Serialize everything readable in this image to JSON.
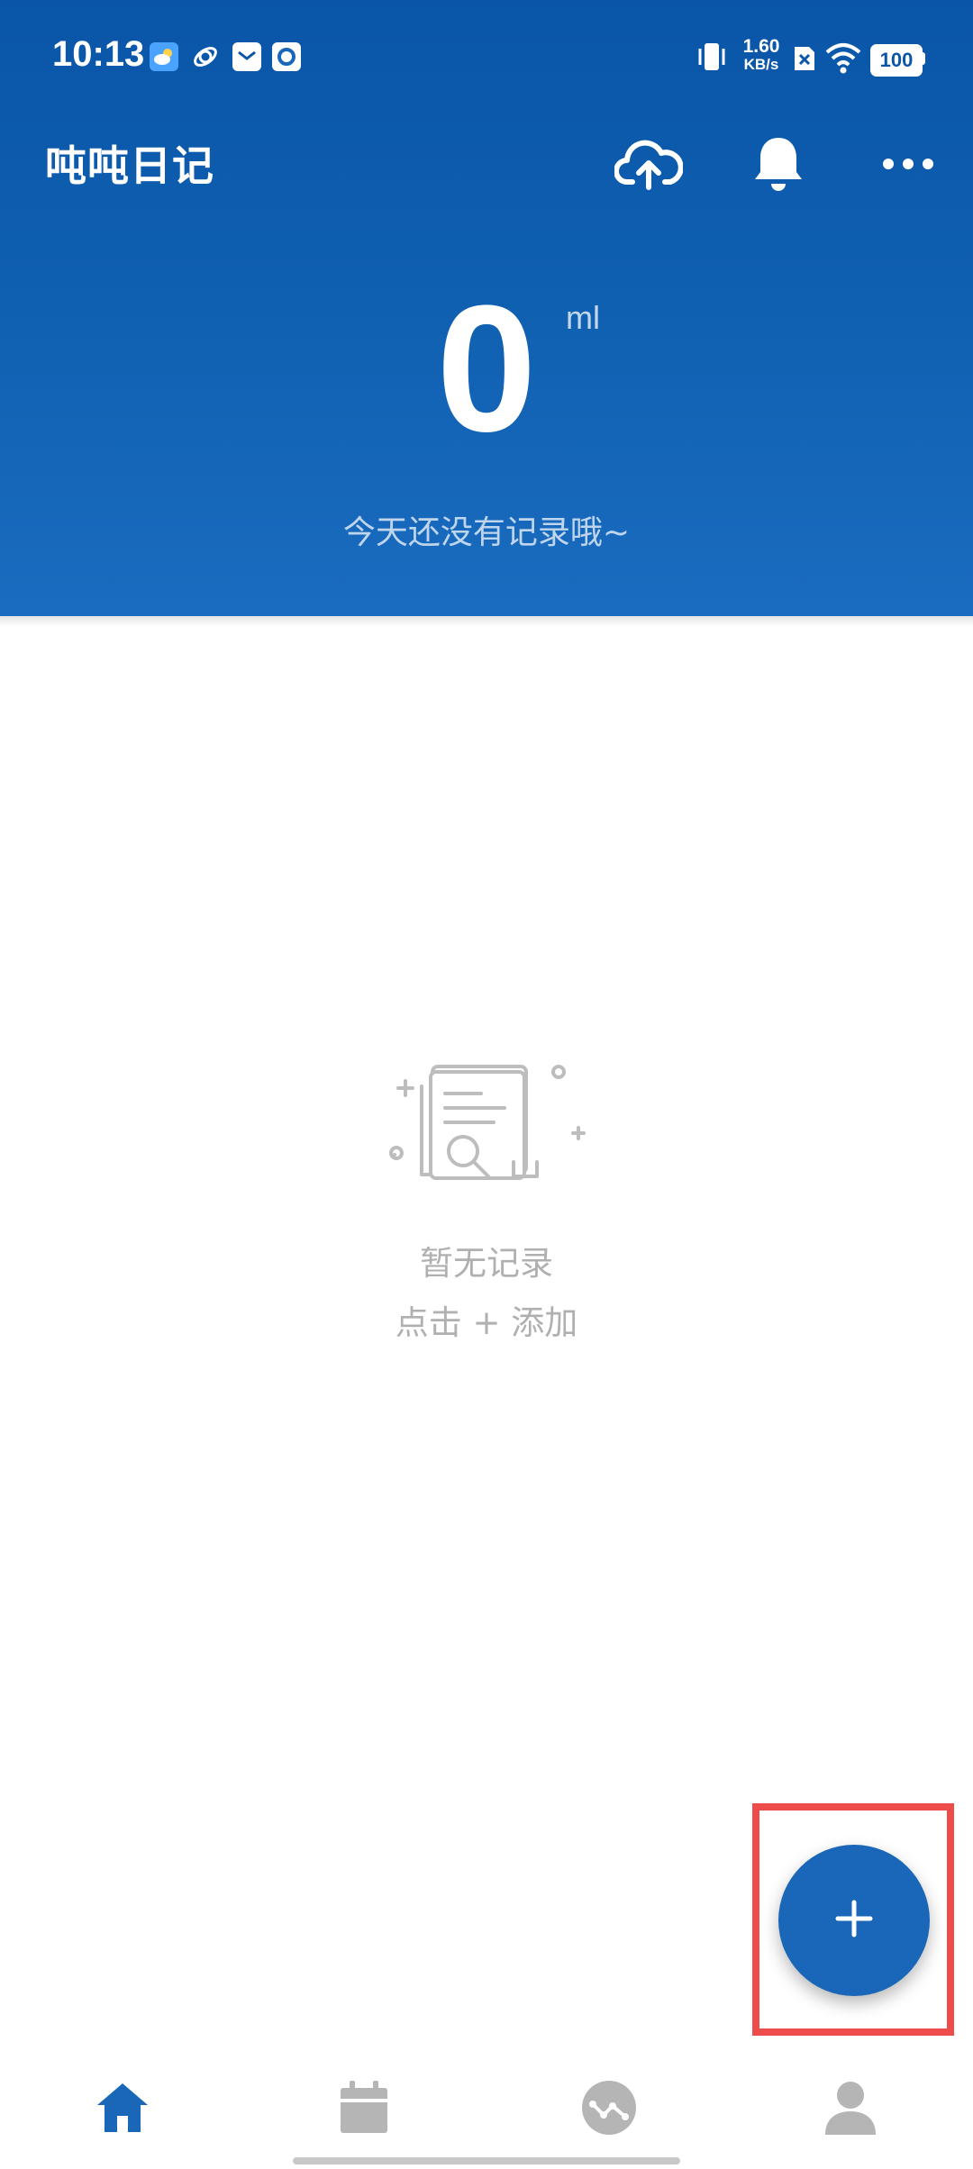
{
  "status_bar": {
    "time": "10:13",
    "net_speed_value": "1.60",
    "net_speed_unit": "KB/s",
    "battery": "100"
  },
  "app_bar": {
    "title": "吨吨日记",
    "icons": [
      "cloud-upload-icon",
      "bell-icon",
      "more-icon"
    ]
  },
  "today": {
    "total": "0",
    "unit": "ml",
    "hint": "今天还没有记录哦~"
  },
  "empty_state": {
    "title": "暂无记录",
    "subtitle": "点击 + 添加"
  },
  "fab": {
    "icon": "plus-icon"
  },
  "bottom_nav": {
    "items": [
      {
        "icon": "home-icon",
        "active": true
      },
      {
        "icon": "calendar-icon",
        "active": false
      },
      {
        "icon": "stats-icon",
        "active": false
      },
      {
        "icon": "profile-icon",
        "active": false
      }
    ]
  },
  "colors": {
    "primary": "#0f5fb0",
    "fab": "#1a66b8",
    "nav_active": "#1a66b8",
    "nav_inactive": "#b5b5b5",
    "empty_text": "#b0b0b0",
    "highlight": "#ee4b4b"
  }
}
